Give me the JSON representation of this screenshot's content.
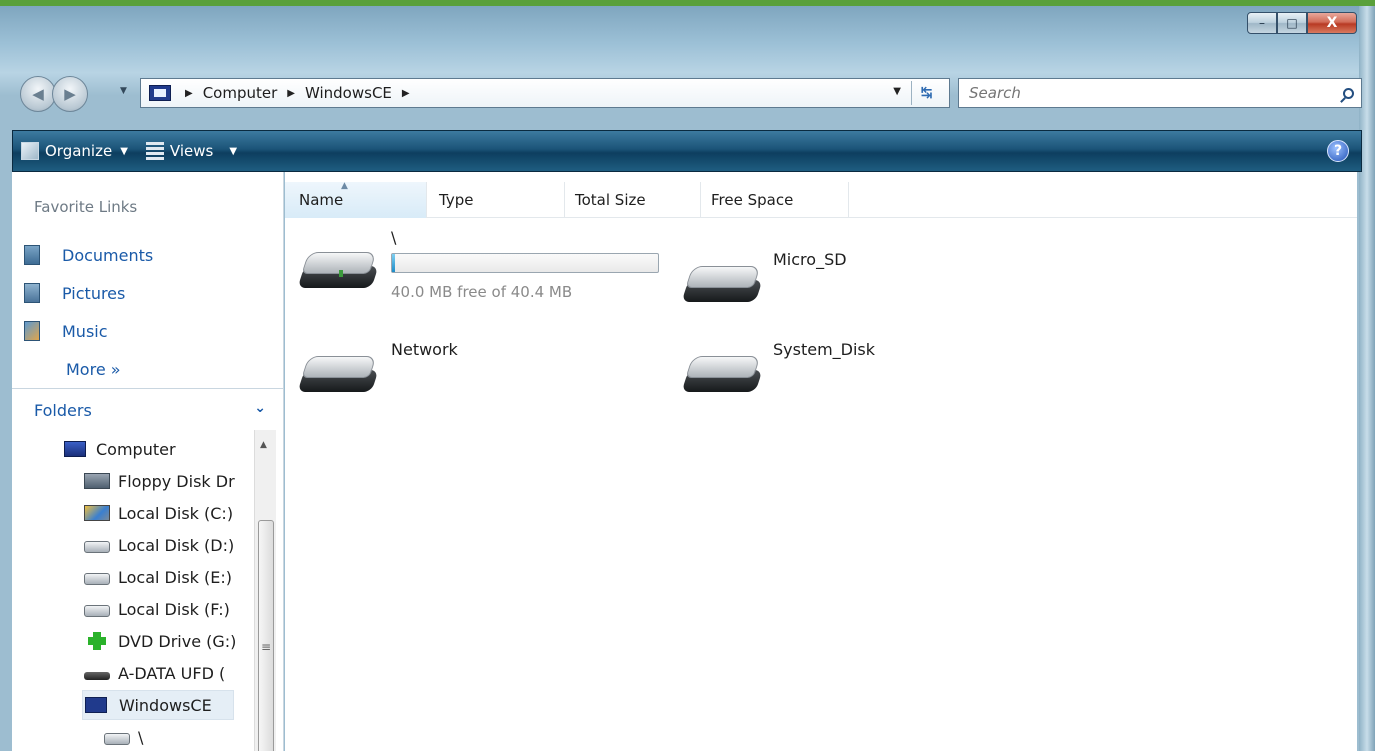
{
  "window": {
    "caption": {
      "minimize": "–",
      "maximize": "□",
      "close": "X"
    }
  },
  "address": {
    "crumbs": [
      "Computer",
      "WindowsCE"
    ],
    "search_placeholder": "Search"
  },
  "toolbar": {
    "organize_label": "Organize",
    "views_label": "Views"
  },
  "favorites": {
    "header": "Favorite Links",
    "items": [
      "Documents",
      "Pictures",
      "Music"
    ],
    "more": "More »"
  },
  "folders": {
    "header": "Folders",
    "tree": [
      "Computer",
      "Floppy Disk Dr",
      "Local Disk (C:)",
      "Local Disk (D:)",
      "Local Disk (E:)",
      "Local Disk (F:)",
      "DVD Drive (G:)",
      "A-DATA UFD (",
      "WindowsCE",
      "\\"
    ]
  },
  "columns": [
    "Name",
    "Type",
    "Total Size",
    "Free Space"
  ],
  "drives": [
    {
      "name": "\\",
      "free_text": "40.0 MB free of 40.4 MB",
      "used_fraction": 0.01
    },
    {
      "name": "Micro_SD"
    },
    {
      "name": "Network"
    },
    {
      "name": "System_Disk"
    }
  ]
}
